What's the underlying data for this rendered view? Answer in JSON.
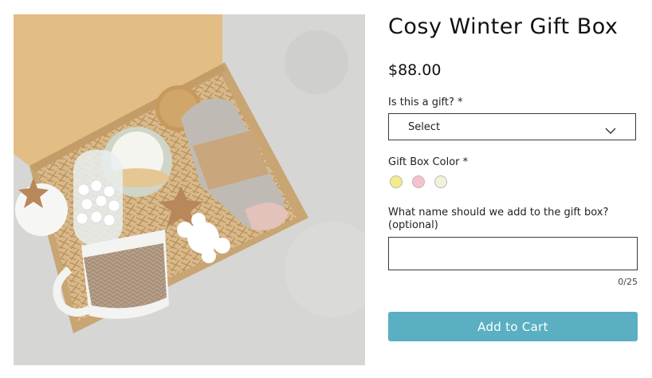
{
  "product": {
    "title": "Cosy Winter Gift Box",
    "price": "$88.00"
  },
  "gift_question": {
    "label": "Is this a gift? *",
    "selected": "Select"
  },
  "color": {
    "label": "Gift Box Color *",
    "swatches": [
      {
        "name": "yellow",
        "hex": "#f4ec8a"
      },
      {
        "name": "pink",
        "hex": "#f6c1cd"
      },
      {
        "name": "cream",
        "hex": "#f3f1dc"
      }
    ]
  },
  "name_field": {
    "label_line1": "What name should we add to the gift box?",
    "label_line2": "(optional)",
    "value": "",
    "counter": "0/25"
  },
  "cart": {
    "button_label": "Add to Cart",
    "button_color": "#5aafc2"
  },
  "image": {
    "alt_description": "gift-box-photo"
  }
}
